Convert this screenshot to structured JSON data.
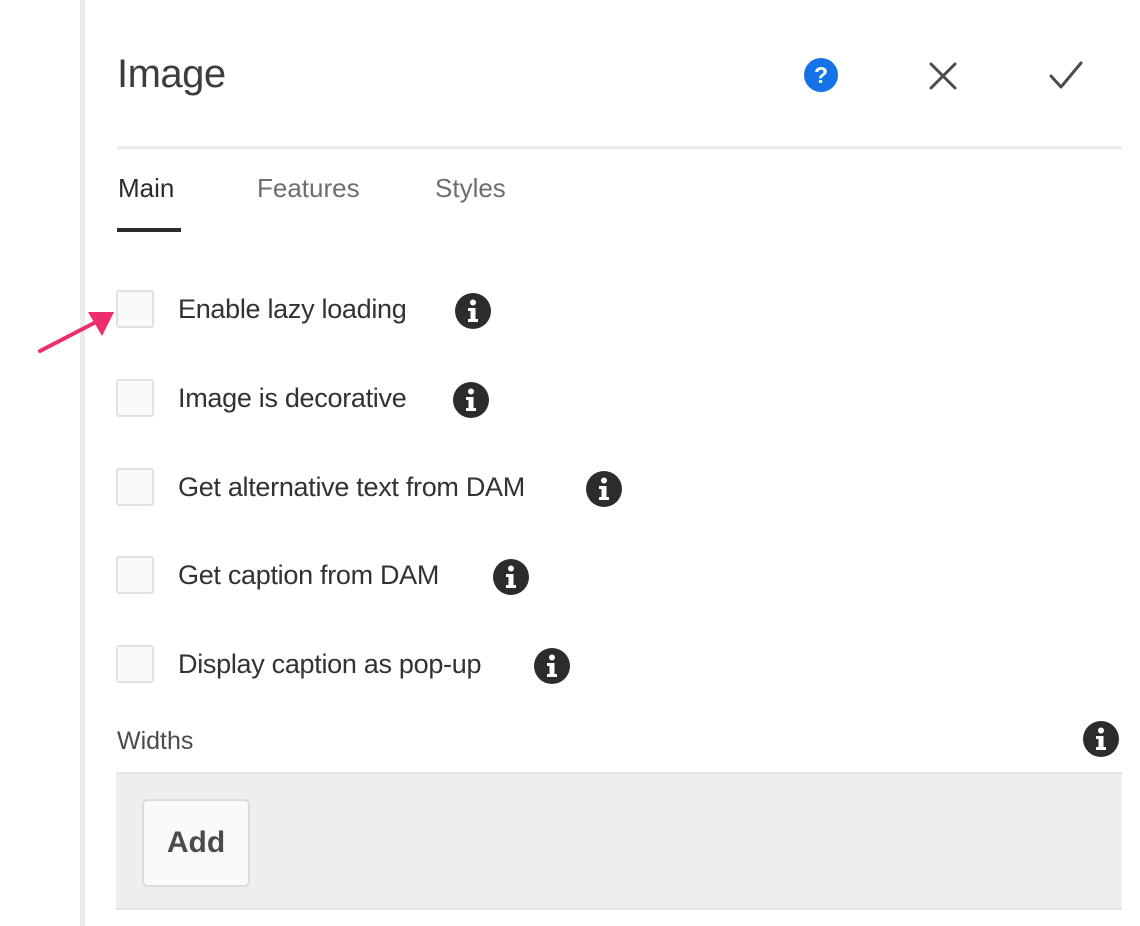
{
  "dialog": {
    "title": "Image",
    "header_icons": [
      "help-icon",
      "close-icon",
      "checkmark-icon"
    ]
  },
  "tabs": [
    {
      "label": "Main",
      "active": true
    },
    {
      "label": "Features",
      "active": false
    },
    {
      "label": "Styles",
      "active": false
    }
  ],
  "checkboxes": [
    {
      "label": "Enable lazy loading",
      "checked": false
    },
    {
      "label": "Image is decorative",
      "checked": false
    },
    {
      "label": "Get alternative text from DAM",
      "checked": false
    },
    {
      "label": "Get caption from DAM",
      "checked": false
    },
    {
      "label": "Display caption as pop-up",
      "checked": false
    }
  ],
  "widths": {
    "label": "Widths",
    "add_label": "Add"
  },
  "colors": {
    "help_icon": "#1473e6",
    "annotation_arrow": "#ec2f6c",
    "info_icon": "#2c2c2c"
  }
}
